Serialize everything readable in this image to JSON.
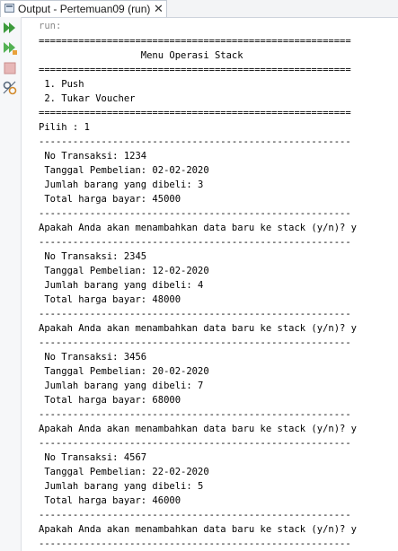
{
  "tab": {
    "title": "Output - Pertemuan09 (run)",
    "close": "✕"
  },
  "toolbar": {
    "icons": [
      "rerun-icon",
      "rerun-with-options-icon",
      "stop-icon",
      "settings-icon"
    ]
  },
  "console": {
    "lines": [
      "run:",
      "=======================================================",
      "                  Menu Operasi Stack",
      "=======================================================",
      " 1. Push",
      " 2. Tukar Voucher",
      "=======================================================",
      "Pilih : 1",
      "-------------------------------------------------------",
      " No Transaksi: 1234",
      " Tanggal Pembelian: 02-02-2020",
      " Jumlah barang yang dibeli: 3",
      " Total harga bayar: 45000",
      "-------------------------------------------------------",
      "Apakah Anda akan menambahkan data baru ke stack (y/n)? y",
      "-------------------------------------------------------",
      " No Transaksi: 2345",
      " Tanggal Pembelian: 12-02-2020",
      " Jumlah barang yang dibeli: 4",
      " Total harga bayar: 48000",
      "-------------------------------------------------------",
      "Apakah Anda akan menambahkan data baru ke stack (y/n)? y",
      "-------------------------------------------------------",
      " No Transaksi: 3456",
      " Tanggal Pembelian: 20-02-2020",
      " Jumlah barang yang dibeli: 7",
      " Total harga bayar: 68000",
      "-------------------------------------------------------",
      "Apakah Anda akan menambahkan data baru ke stack (y/n)? y",
      "-------------------------------------------------------",
      " No Transaksi: 4567",
      " Tanggal Pembelian: 22-02-2020",
      " Jumlah barang yang dibeli: 5",
      " Total harga bayar: 46000",
      "-------------------------------------------------------",
      "Apakah Anda akan menambahkan data baru ke stack (y/n)? y",
      "-------------------------------------------------------"
    ]
  }
}
